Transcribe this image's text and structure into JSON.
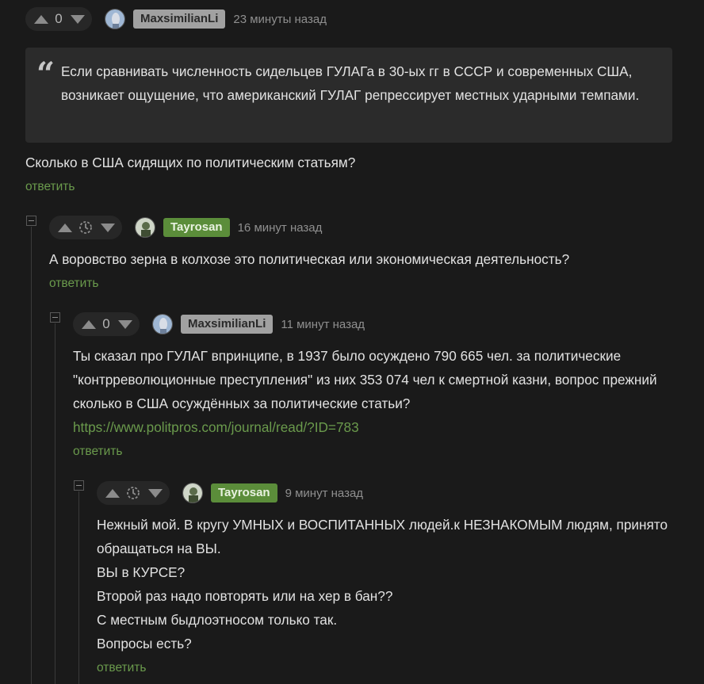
{
  "comments": [
    {
      "username": "MaxsimilianLi",
      "score": "0",
      "time": "23 минуты назад",
      "quote": "Если сравнивать численность сидельцев ГУЛАГа в 30-ых гг в СССР и современных США, возникает ощущение, что американский ГУЛАГ репрессирует местных ударными темпами.",
      "text": "Сколько в США сидящих по политическим статьям?",
      "reply_label": "ответить"
    },
    {
      "username": "Tayrosan",
      "time": "16 минут назад",
      "text": "А воровство зерна в колхозе это политическая или экономическая деятельность?",
      "reply_label": "ответить"
    },
    {
      "username": "MaxsimilianLi",
      "score": "0",
      "time": "11 минут назад",
      "text": "Ты сказал про ГУЛАГ впринципе, в 1937 было осуждено 790 665 чел. за политические \"контрреволюционные преступления\" из них 353 074 чел к смертной казни, вопрос прежний сколько в США осуждённых за политические статьи?",
      "link": "https://www.politpros.com/journal/read/?ID=783",
      "reply_label": "ответить"
    },
    {
      "username": "Tayrosan",
      "time": "9 минут назад",
      "lines": [
        "Нежный мой. В кругу УМНЫХ и ВОСПИТАННЫХ людей.к НЕЗНАКОМЫМ людям, принято обращаться на ВЫ.",
        "ВЫ в КУРСЕ?",
        "Второй раз надо повторять или на хер в бан??",
        "С местным быдлоэтносом только так.",
        "Вопросы есть?"
      ],
      "reply_label": "ответить"
    }
  ],
  "colors": {
    "background": "#1a1a1a",
    "accent_green": "#6a9a4c",
    "user_grey_badge": "#a1a1a1",
    "user_green_badge": "#5b8d3a"
  }
}
